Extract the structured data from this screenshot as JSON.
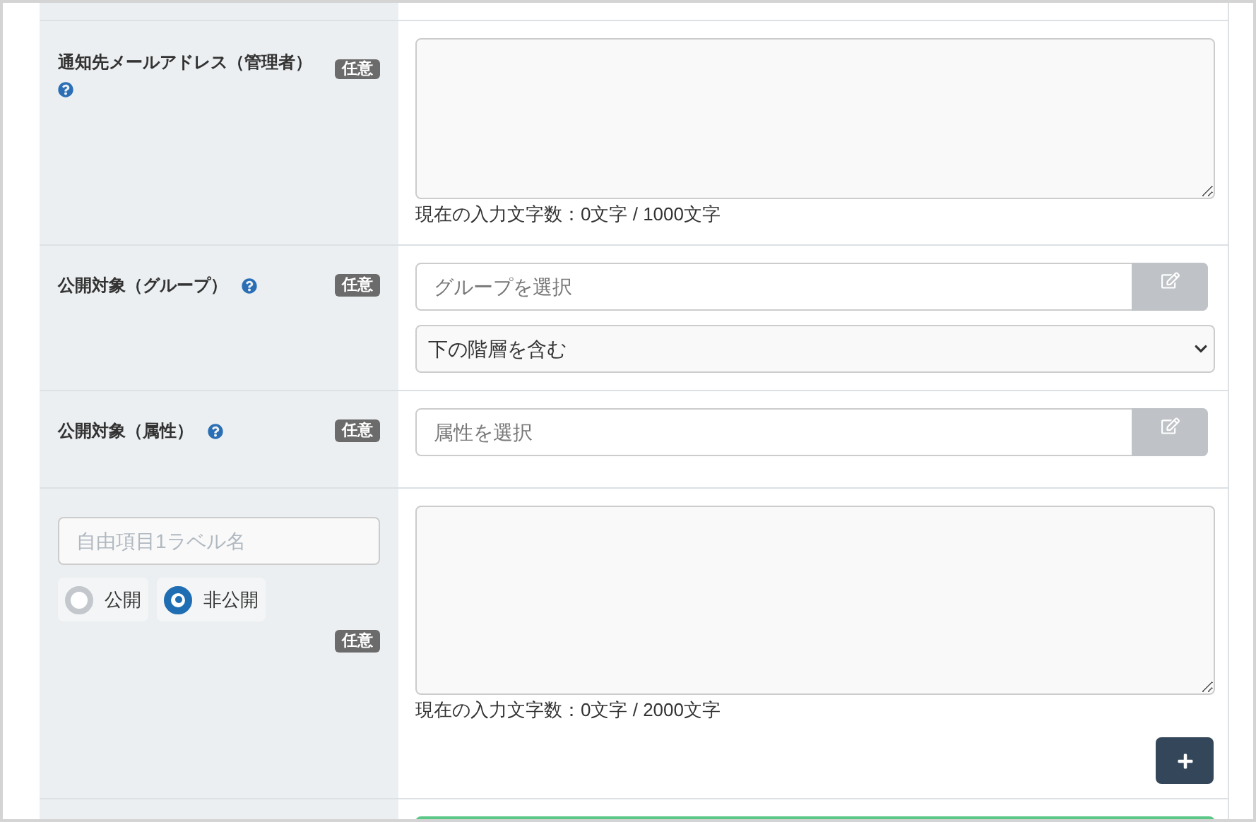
{
  "rows": [
    {
      "kind": "textarea",
      "label": "通知先メールアドレス（管理者）",
      "badge": "任意",
      "counter": "現在の入力文字数：0文字 / 1000文字"
    },
    {
      "kind": "picker",
      "label": "公開対象（グループ）",
      "badge": "任意",
      "picker": {
        "placeholder": "グループを選択"
      },
      "select": {
        "value": "下の階層を含む"
      }
    },
    {
      "kind": "picker",
      "label": "公開対象（属性）",
      "badge": "任意",
      "picker": {
        "placeholder": "属性を選択"
      }
    },
    {
      "kind": "custom",
      "label_field": {
        "placeholder": "自由項目1ラベル名"
      },
      "radios": [
        {
          "label": "公開",
          "selected": false
        },
        {
          "label": "非公開",
          "selected": true
        }
      ],
      "badge": "任意",
      "counter": "現在の入力文字数：0文字 / 2000文字"
    }
  ]
}
